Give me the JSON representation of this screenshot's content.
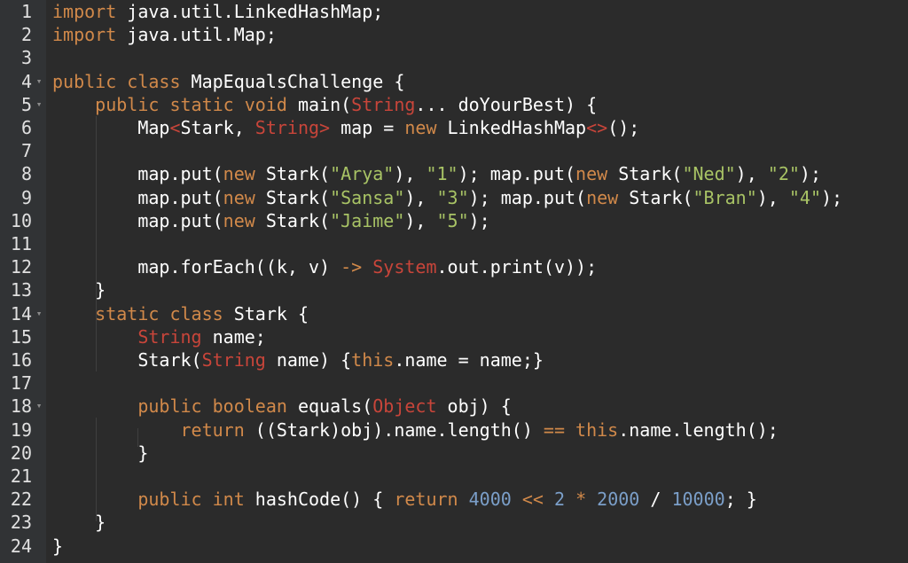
{
  "editor": {
    "lines": [
      {
        "n": "1",
        "fold": "",
        "indent": 0,
        "tokens": [
          [
            "kw",
            "import"
          ],
          [
            "p",
            " java.util.LinkedHashMap;"
          ]
        ]
      },
      {
        "n": "2",
        "fold": "",
        "indent": 0,
        "tokens": [
          [
            "kw",
            "import"
          ],
          [
            "p",
            " java.util.Map;"
          ]
        ]
      },
      {
        "n": "3",
        "fold": "",
        "indent": 0,
        "tokens": []
      },
      {
        "n": "4",
        "fold": "▾",
        "indent": 0,
        "tokens": [
          [
            "kw",
            "public class"
          ],
          [
            "p",
            " MapEqualsChallenge {"
          ]
        ]
      },
      {
        "n": "5",
        "fold": "▾",
        "indent": 1,
        "tokens": [
          [
            "kw",
            "public static void"
          ],
          [
            "p",
            " main("
          ],
          [
            "cls",
            "String"
          ],
          [
            "p",
            "... doYourBest) {"
          ]
        ]
      },
      {
        "n": "6",
        "fold": "",
        "indent": 2,
        "tokens": [
          [
            "p",
            "Map"
          ],
          [
            "cls",
            "<"
          ],
          [
            "p",
            "Stark, "
          ],
          [
            "cls",
            "String"
          ],
          [
            "cls",
            ">"
          ],
          [
            "p",
            " map = "
          ],
          [
            "kw",
            "new"
          ],
          [
            "p",
            " LinkedHashMap"
          ],
          [
            "cls",
            "<>"
          ],
          [
            "p",
            "();"
          ]
        ]
      },
      {
        "n": "7",
        "fold": "",
        "indent": 2,
        "tokens": []
      },
      {
        "n": "8",
        "fold": "",
        "indent": 2,
        "tokens": [
          [
            "p",
            "map.put("
          ],
          [
            "kw",
            "new"
          ],
          [
            "p",
            " Stark("
          ],
          [
            "str",
            "\"Arya\""
          ],
          [
            "p",
            "), "
          ],
          [
            "str",
            "\"1\""
          ],
          [
            "p",
            "); map.put("
          ],
          [
            "kw",
            "new"
          ],
          [
            "p",
            " Stark("
          ],
          [
            "str",
            "\"Ned\""
          ],
          [
            "p",
            "), "
          ],
          [
            "str",
            "\"2\""
          ],
          [
            "p",
            ");"
          ]
        ]
      },
      {
        "n": "9",
        "fold": "",
        "indent": 2,
        "tokens": [
          [
            "p",
            "map.put("
          ],
          [
            "kw",
            "new"
          ],
          [
            "p",
            " Stark("
          ],
          [
            "str",
            "\"Sansa\""
          ],
          [
            "p",
            "), "
          ],
          [
            "str",
            "\"3\""
          ],
          [
            "p",
            "); map.put("
          ],
          [
            "kw",
            "new"
          ],
          [
            "p",
            " Stark("
          ],
          [
            "str",
            "\"Bran\""
          ],
          [
            "p",
            "), "
          ],
          [
            "str",
            "\"4\""
          ],
          [
            "p",
            ");"
          ]
        ]
      },
      {
        "n": "10",
        "fold": "",
        "indent": 2,
        "tokens": [
          [
            "p",
            "map.put("
          ],
          [
            "kw",
            "new"
          ],
          [
            "p",
            " Stark("
          ],
          [
            "str",
            "\"Jaime\""
          ],
          [
            "p",
            "), "
          ],
          [
            "str",
            "\"5\""
          ],
          [
            "p",
            ");"
          ]
        ]
      },
      {
        "n": "11",
        "fold": "",
        "indent": 2,
        "tokens": []
      },
      {
        "n": "12",
        "fold": "",
        "indent": 2,
        "tokens": [
          [
            "p",
            "map.forEach((k, v) "
          ],
          [
            "kw",
            "->"
          ],
          [
            "p",
            " "
          ],
          [
            "cls",
            "System"
          ],
          [
            "p",
            ".out.print(v));"
          ]
        ]
      },
      {
        "n": "13",
        "fold": "",
        "indent": 1,
        "tokens": [
          [
            "p",
            "}"
          ]
        ]
      },
      {
        "n": "14",
        "fold": "▾",
        "indent": 1,
        "tokens": [
          [
            "kw",
            "static class"
          ],
          [
            "p",
            " Stark {"
          ]
        ]
      },
      {
        "n": "15",
        "fold": "",
        "indent": 2,
        "tokens": [
          [
            "cls",
            "String"
          ],
          [
            "p",
            " name;"
          ]
        ]
      },
      {
        "n": "16",
        "fold": "",
        "indent": 2,
        "tokens": [
          [
            "p",
            "Stark("
          ],
          [
            "cls",
            "String"
          ],
          [
            "p",
            " name) {"
          ],
          [
            "kw",
            "this"
          ],
          [
            "p",
            ".name = name;}"
          ]
        ]
      },
      {
        "n": "17",
        "fold": "",
        "indent": 2,
        "tokens": []
      },
      {
        "n": "18",
        "fold": "▾",
        "indent": 2,
        "tokens": [
          [
            "kw",
            "public boolean"
          ],
          [
            "p",
            " equals("
          ],
          [
            "cls",
            "Object"
          ],
          [
            "p",
            " obj) {"
          ]
        ]
      },
      {
        "n": "19",
        "fold": "",
        "indent": 3,
        "tokens": [
          [
            "kw",
            "return"
          ],
          [
            "p",
            " ((Stark)obj).name.length() "
          ],
          [
            "kw",
            "=="
          ],
          [
            "p",
            " "
          ],
          [
            "kw",
            "this"
          ],
          [
            "p",
            ".name.length();"
          ]
        ]
      },
      {
        "n": "20",
        "fold": "",
        "indent": 2,
        "tokens": [
          [
            "p",
            "}"
          ]
        ]
      },
      {
        "n": "21",
        "fold": "",
        "indent": 2,
        "tokens": []
      },
      {
        "n": "22",
        "fold": "",
        "indent": 2,
        "tokens": [
          [
            "kw",
            "public int"
          ],
          [
            "p",
            " hashCode() { "
          ],
          [
            "kw",
            "return"
          ],
          [
            "p",
            " "
          ],
          [
            "num",
            "4000"
          ],
          [
            "p",
            " "
          ],
          [
            "kw",
            "<<"
          ],
          [
            "p",
            " "
          ],
          [
            "num",
            "2"
          ],
          [
            "p",
            " "
          ],
          [
            "kw",
            "*"
          ],
          [
            "p",
            " "
          ],
          [
            "num",
            "2000"
          ],
          [
            "p",
            " / "
          ],
          [
            "num",
            "10000"
          ],
          [
            "p",
            "; }"
          ]
        ]
      },
      {
        "n": "23",
        "fold": "",
        "indent": 1,
        "tokens": [
          [
            "p",
            "}"
          ]
        ]
      },
      {
        "n": "24",
        "fold": "",
        "indent": 0,
        "tokens": [
          [
            "p",
            "}"
          ]
        ]
      }
    ]
  },
  "colors": {
    "background": "#2b2b2b",
    "gutter": "#313335",
    "text": "#ffffff",
    "keyword": "#d1894a",
    "class": "#c8453a",
    "string": "#a8c365",
    "number": "#7b9fc9",
    "fold_marker": "#8a8a8a"
  }
}
